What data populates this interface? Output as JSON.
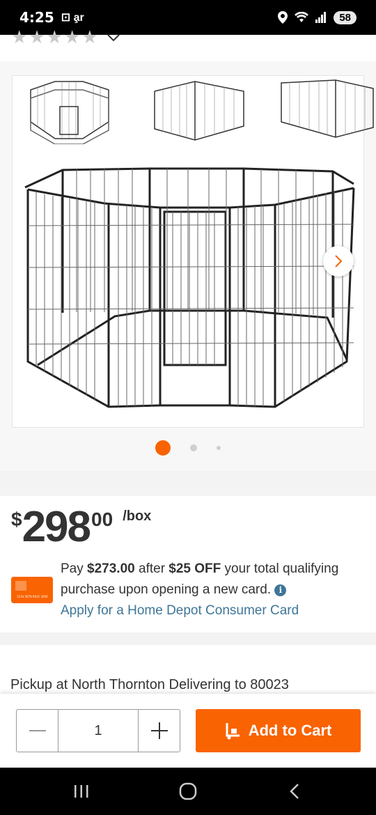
{
  "status_bar": {
    "time": "4:25",
    "left_icons": "⊡ a̧r",
    "battery": "58"
  },
  "rating": {
    "stars": 5,
    "filled": 0
  },
  "gallery": {
    "thumbnails": [
      "octagon-pen",
      "corner-pen",
      "rectangle-pen"
    ],
    "active_index": 0,
    "total": 3
  },
  "price": {
    "currency": "$",
    "whole": "298",
    "cents": "00",
    "unit": "/box"
  },
  "promo": {
    "line_prefix": "Pay ",
    "after_price": "$273.00",
    "after_text": " after ",
    "discount": "$25 OFF",
    "rest": " your total qualifying purchase upon opening a new card. ",
    "info_glyph": "i",
    "apply_link": "Apply for a Home Depot Consumer Card",
    "card_label": "1234 5678 9012 3456"
  },
  "fulfillment": {
    "text": "Pickup at North Thornton  Delivering to 80023"
  },
  "cart": {
    "quantity": "1",
    "add_label": "Add to Cart"
  },
  "colors": {
    "brand": "#f96302",
    "link": "#3e7697"
  }
}
